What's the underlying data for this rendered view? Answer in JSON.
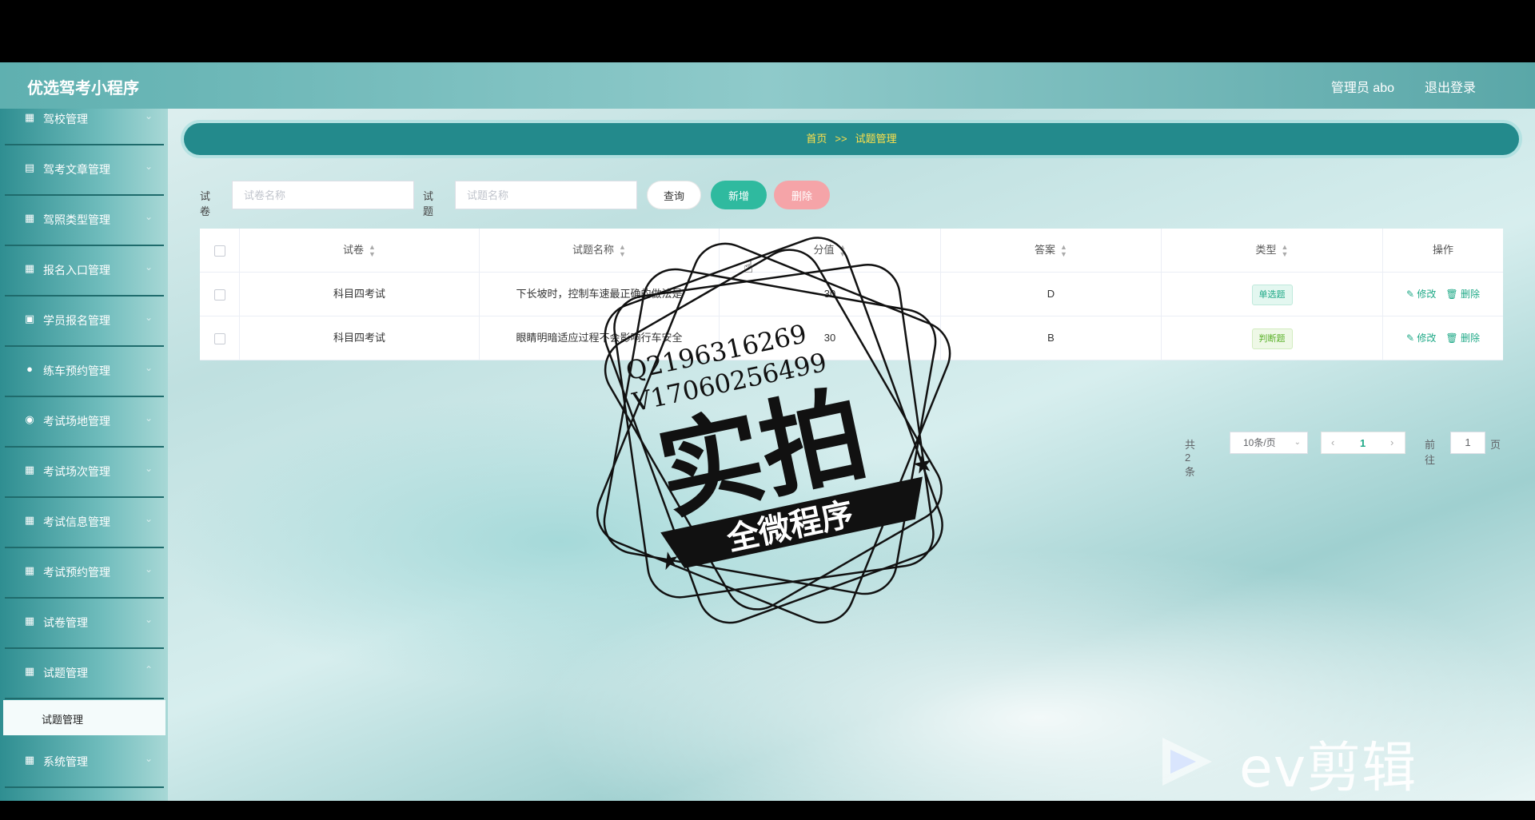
{
  "app": {
    "title": "优选驾考小程序"
  },
  "header": {
    "user": "管理员 abo",
    "logout": "退出登录"
  },
  "sidebar": {
    "items": [
      {
        "label": "驾校管理",
        "icon": "grid-icon"
      },
      {
        "label": "驾考文章管理",
        "icon": "clipboard-icon"
      },
      {
        "label": "驾照类型管理",
        "icon": "grid-icon"
      },
      {
        "label": "报名入口管理",
        "icon": "grid-icon"
      },
      {
        "label": "学员报名管理",
        "icon": "briefcase-icon"
      },
      {
        "label": "练车预约管理",
        "icon": "user-icon"
      },
      {
        "label": "考试场地管理",
        "icon": "location-icon"
      },
      {
        "label": "考试场次管理",
        "icon": "grid-icon"
      },
      {
        "label": "考试信息管理",
        "icon": "grid-icon"
      },
      {
        "label": "考试预约管理",
        "icon": "grid-icon"
      },
      {
        "label": "试卷管理",
        "icon": "grid-icon"
      },
      {
        "label": "试题管理",
        "icon": "grid-icon"
      },
      {
        "label": "系统管理",
        "icon": "grid-icon"
      }
    ],
    "active_sub": "试题管理"
  },
  "breadcrumb": {
    "home": "首页",
    "sep": ">>",
    "current": "试题管理"
  },
  "search": {
    "paper_label": "试卷",
    "paper_placeholder": "试卷名称",
    "question_label": "试题",
    "question_placeholder": "试题名称",
    "query": "查询",
    "add": "新增",
    "delete": "删除"
  },
  "table": {
    "columns": [
      "试卷",
      "试题名称",
      "分值",
      "答案",
      "类型",
      "操作"
    ],
    "rows": [
      {
        "paper": "科目四考试",
        "question": "下长坡时，控制车速最正确的做法是",
        "score": "30",
        "answer": "D",
        "type": "单选题",
        "edit": "修改",
        "delete": "删除"
      },
      {
        "paper": "科目四考试",
        "question": "眼睛明暗适应过程不会影响行车安全",
        "score": "30",
        "answer": "B",
        "type": "判断题",
        "edit": "修改",
        "delete": "删除"
      }
    ]
  },
  "pagination": {
    "total": "共 2 条",
    "page_size": "10条/页",
    "current": "1",
    "goto": "前往",
    "goto_value": "1",
    "unit": "页"
  },
  "overlay": {
    "stamp_line1": "Q2196316269",
    "stamp_line2": "V17060256499",
    "stamp_main": "实拍",
    "stamp_banner": "全微程序",
    "watermark": "ev剪辑"
  }
}
